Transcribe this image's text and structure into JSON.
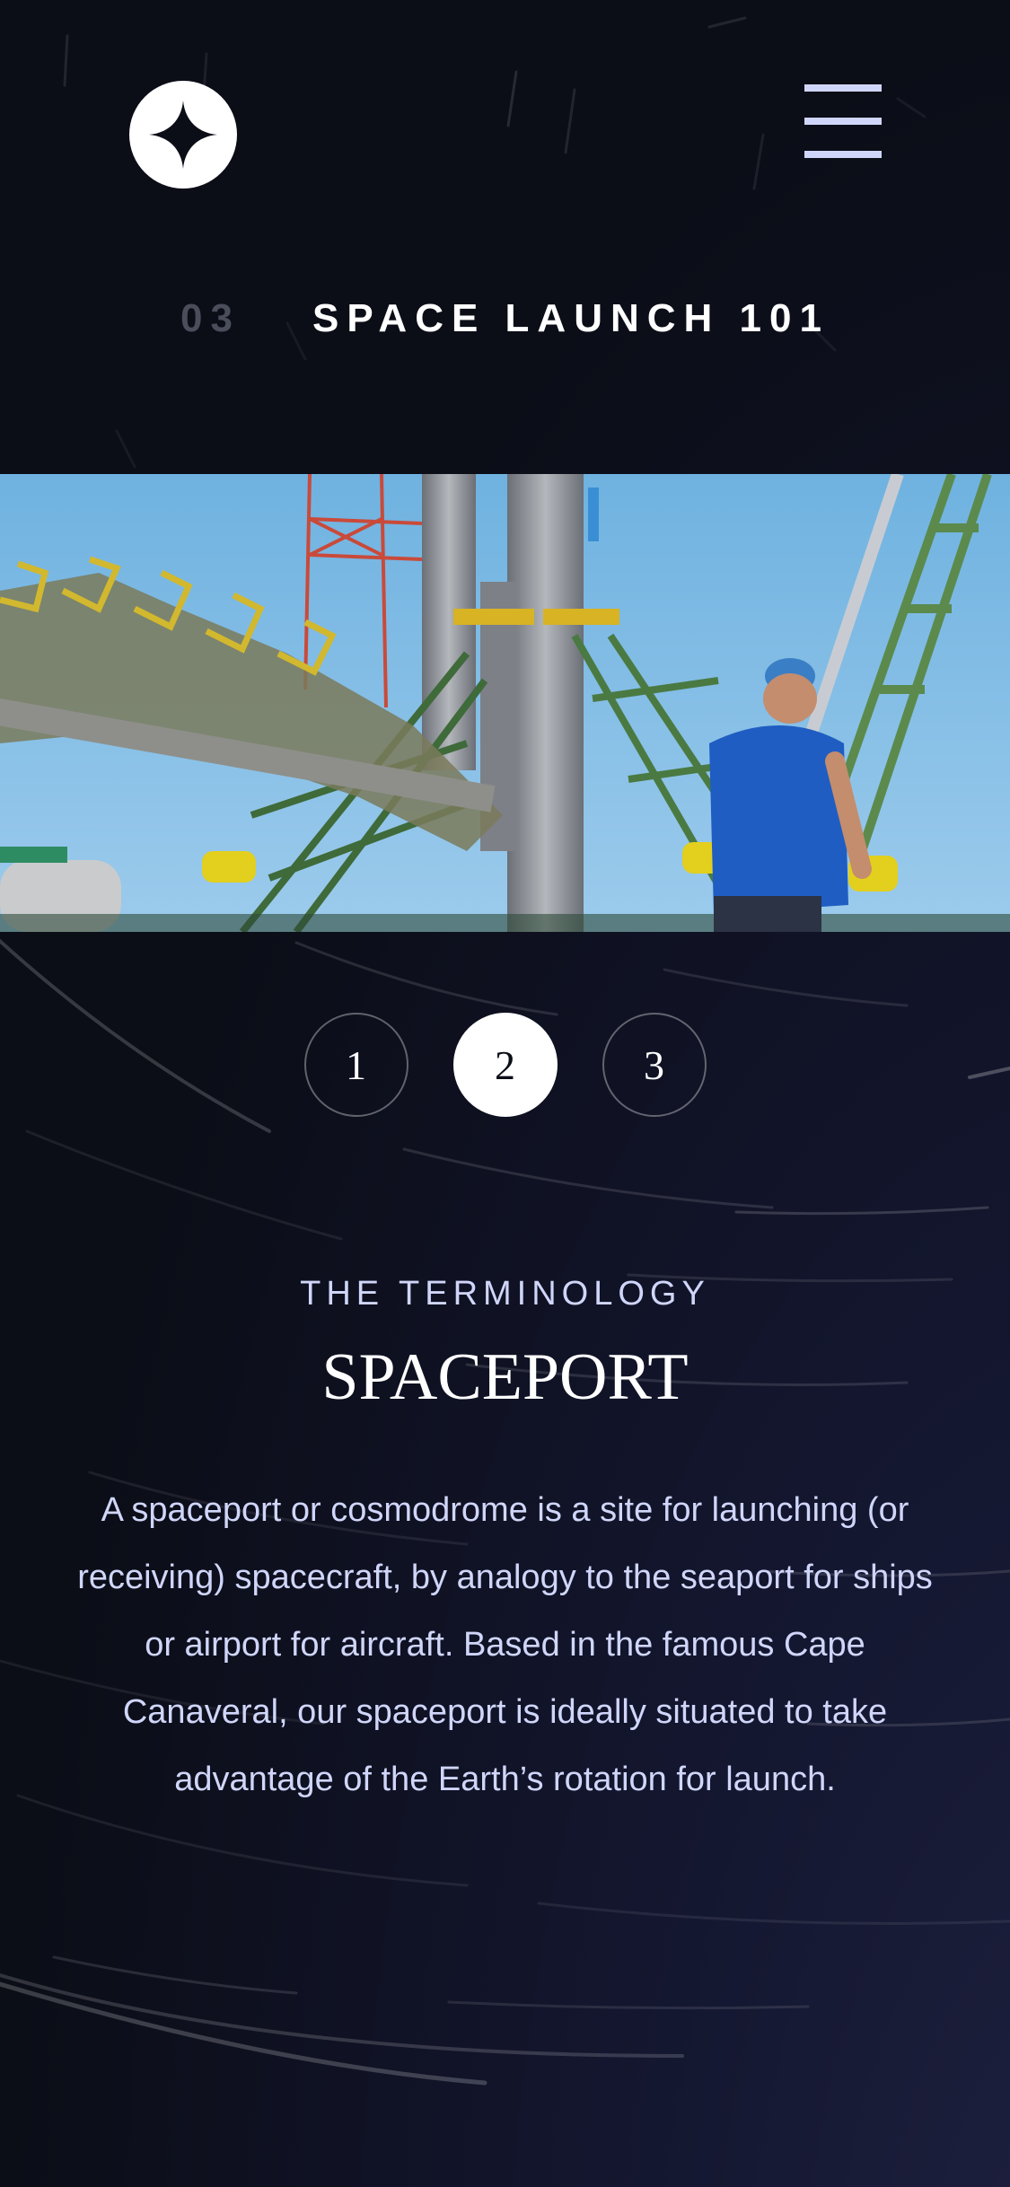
{
  "header": {
    "logo_icon": "star-icon",
    "menu_icon": "hamburger-menu-icon"
  },
  "heading": {
    "number": "03",
    "title": "SPACE LAUNCH 101"
  },
  "hero": {
    "subject": "rocket-launch-pad-image"
  },
  "pager": {
    "items": [
      {
        "label": "1",
        "active": false
      },
      {
        "label": "2",
        "active": true
      },
      {
        "label": "3",
        "active": false
      }
    ]
  },
  "content": {
    "eyebrow": "THE TERMINOLOGY",
    "term": "SPACEPORT",
    "description": "A spaceport or cosmodrome is a site for launching (or receiving) spacecraft, by analogy to the seaport for ships or airport for aircraft. Based in the famous Cape Canaveral, our spaceport is ideally situated to take advantage of the Earth’s rotation for launch."
  },
  "colors": {
    "background": "#0b0d17",
    "accent": "#d0d6f9",
    "white": "#ffffff",
    "muted_number": "#4a4d5a"
  }
}
